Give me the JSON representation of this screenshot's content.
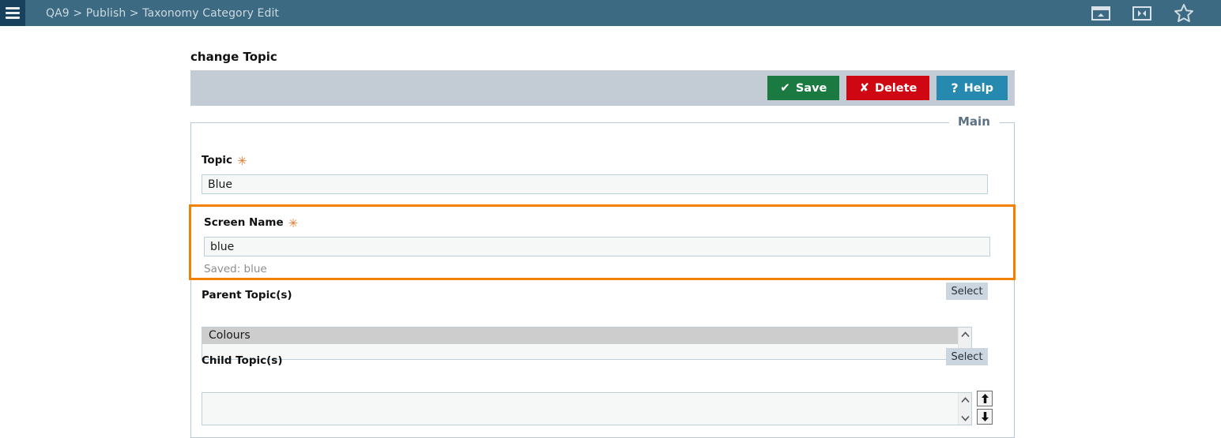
{
  "header": {
    "menu_icon": "hamburger-menu-icon",
    "breadcrumb": "QA9 > Publish > Taxonomy Category Edit",
    "icons": [
      {
        "name": "dock-panel-icon",
        "title": "Dock panel"
      },
      {
        "name": "collapse-horizontal-icon",
        "title": "Collapse"
      },
      {
        "name": "favorite-star-icon",
        "title": "Favorite"
      }
    ]
  },
  "page": {
    "title": "change Topic"
  },
  "toolbar": {
    "save_label": "Save",
    "save_glyph": "✔",
    "save_color": "#1b7a42",
    "delete_label": "Delete",
    "delete_glyph": "✘",
    "delete_color": "#cf0712",
    "help_label": "Help",
    "help_glyph": "?",
    "help_color": "#2689b0"
  },
  "fieldset": {
    "legend": "Main",
    "legend_color": "#5c7186"
  },
  "form": {
    "required_marker": "✳",
    "required_color": "#e8772b",
    "topic": {
      "label": "Topic",
      "required": true,
      "value": "Blue",
      "placeholder": ""
    },
    "screen_name": {
      "label": "Screen Name",
      "required": true,
      "value": "blue",
      "placeholder": "",
      "saved_note": "Saved: blue",
      "highlight_color": "#f48000"
    },
    "parent_topics": {
      "label": "Parent Topic(s)",
      "select_button": "Select",
      "items": [
        {
          "text": "Colours",
          "selected": true
        }
      ]
    },
    "child_topics": {
      "label": "Child Topic(s)",
      "select_button": "Select",
      "items": [],
      "move_up_label": "Move up",
      "move_down_label": "Move down"
    },
    "scroll": {
      "up_glyph": "⌃",
      "down_glyph": "⌄"
    }
  }
}
